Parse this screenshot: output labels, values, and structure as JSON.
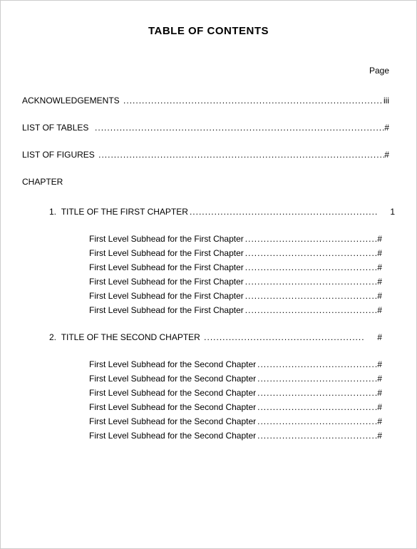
{
  "title": "TABLE OF CONTENTS",
  "page_label": "Page",
  "front_matter": [
    {
      "label": "ACKNOWLEDGEMENTS",
      "page": "iii"
    },
    {
      "label": "LIST OF TABLES",
      "page": "#"
    },
    {
      "label": "LIST OF FIGURES",
      "page": "#"
    }
  ],
  "chapter_heading": "CHAPTER",
  "chapters": [
    {
      "number": "1.",
      "title": "TITLE OF THE FIRST CHAPTER",
      "page": "1",
      "subheads": [
        {
          "label": "First Level Subhead for the First Chapter",
          "page": "#"
        },
        {
          "label": "First Level Subhead for the First Chapter",
          "page": "#"
        },
        {
          "label": "First Level Subhead for the First Chapter",
          "page": "#"
        },
        {
          "label": "First Level Subhead for the First Chapter",
          "page": "#"
        },
        {
          "label": "First Level Subhead for the First Chapter",
          "page": "#"
        },
        {
          "label": "First Level Subhead for the First Chapter",
          "page": "#"
        }
      ]
    },
    {
      "number": "2.",
      "title": "TITLE OF THE SECOND CHAPTER",
      "page": "#",
      "subheads": [
        {
          "label": "First Level Subhead for the Second Chapter",
          "page": "#"
        },
        {
          "label": "First Level Subhead for the Second Chapter",
          "page": "#"
        },
        {
          "label": "First Level Subhead for the Second Chapter",
          "page": "#"
        },
        {
          "label": "First Level Subhead for the Second Chapter",
          "page": "#"
        },
        {
          "label": "First Level Subhead for the Second Chapter",
          "page": "#"
        },
        {
          "label": "First Level Subhead for the Second Chapter",
          "page": "#"
        }
      ]
    }
  ]
}
